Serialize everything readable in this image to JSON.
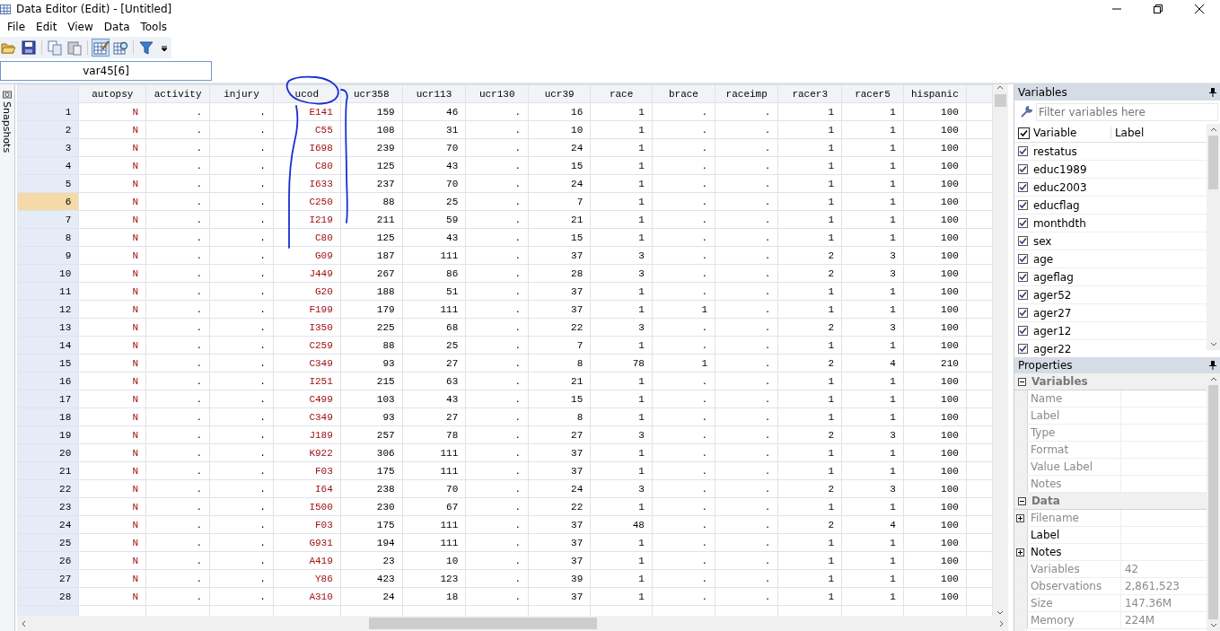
{
  "window": {
    "title": "Data Editor (Edit) - [Untitled]"
  },
  "menu": [
    "File",
    "Edit",
    "View",
    "Data",
    "Tools"
  ],
  "toolbar": [
    {
      "kind": "open",
      "selected": false
    },
    {
      "kind": "save",
      "selected": false
    },
    {
      "kind": "copy",
      "selected": false
    },
    {
      "kind": "paste",
      "selected": false
    },
    {
      "kind": "edit",
      "selected": true
    },
    {
      "kind": "browse",
      "selected": false
    },
    {
      "kind": "filter",
      "selected": false
    }
  ],
  "cell_reference": "var45[6]",
  "snapshots_tab": "Snapshots",
  "table": {
    "columns": [
      {
        "name": "autopsy",
        "kind": "string"
      },
      {
        "name": "activity",
        "kind": "numeric"
      },
      {
        "name": "injury",
        "kind": "numeric"
      },
      {
        "name": "ucod",
        "kind": "string"
      },
      {
        "name": "ucr358",
        "kind": "numeric"
      },
      {
        "name": "ucr113",
        "kind": "numeric"
      },
      {
        "name": "ucr130",
        "kind": "numeric"
      },
      {
        "name": "ucr39",
        "kind": "numeric"
      },
      {
        "name": "race",
        "kind": "numeric"
      },
      {
        "name": "brace",
        "kind": "numeric"
      },
      {
        "name": "raceimp",
        "kind": "numeric"
      },
      {
        "name": "racer3",
        "kind": "numeric"
      },
      {
        "name": "racer5",
        "kind": "numeric"
      },
      {
        "name": "hispanic",
        "kind": "numeric"
      }
    ],
    "rows": [
      {
        "n": "1",
        "selected": false,
        "cells": [
          "N",
          ".",
          ".",
          "E141",
          "159",
          "46",
          ".",
          "16",
          "1",
          ".",
          ".",
          "1",
          "1",
          "100"
        ]
      },
      {
        "n": "2",
        "selected": false,
        "cells": [
          "N",
          ".",
          ".",
          "C55",
          "108",
          "31",
          ".",
          "10",
          "1",
          ".",
          ".",
          "1",
          "1",
          "100"
        ]
      },
      {
        "n": "3",
        "selected": false,
        "cells": [
          "N",
          ".",
          ".",
          "I698",
          "239",
          "70",
          ".",
          "24",
          "1",
          ".",
          ".",
          "1",
          "1",
          "100"
        ]
      },
      {
        "n": "4",
        "selected": false,
        "cells": [
          "N",
          ".",
          ".",
          "C80",
          "125",
          "43",
          ".",
          "15",
          "1",
          ".",
          ".",
          "1",
          "1",
          "100"
        ]
      },
      {
        "n": "5",
        "selected": false,
        "cells": [
          "N",
          ".",
          ".",
          "I633",
          "237",
          "70",
          ".",
          "24",
          "1",
          ".",
          ".",
          "1",
          "1",
          "100"
        ]
      },
      {
        "n": "6",
        "selected": true,
        "cells": [
          "N",
          ".",
          ".",
          "C250",
          "88",
          "25",
          ".",
          "7",
          "1",
          ".",
          ".",
          "1",
          "1",
          "100"
        ]
      },
      {
        "n": "7",
        "selected": false,
        "cells": [
          "N",
          ".",
          ".",
          "I219",
          "211",
          "59",
          ".",
          "21",
          "1",
          ".",
          ".",
          "1",
          "1",
          "100"
        ]
      },
      {
        "n": "8",
        "selected": false,
        "cells": [
          "N",
          ".",
          ".",
          "C80",
          "125",
          "43",
          ".",
          "15",
          "1",
          ".",
          ".",
          "1",
          "1",
          "100"
        ]
      },
      {
        "n": "9",
        "selected": false,
        "cells": [
          "N",
          ".",
          ".",
          "G09",
          "187",
          "111",
          ".",
          "37",
          "3",
          ".",
          ".",
          "2",
          "3",
          "100"
        ]
      },
      {
        "n": "10",
        "selected": false,
        "cells": [
          "N",
          ".",
          ".",
          "J449",
          "267",
          "86",
          ".",
          "28",
          "3",
          ".",
          ".",
          "2",
          "3",
          "100"
        ]
      },
      {
        "n": "11",
        "selected": false,
        "cells": [
          "N",
          ".",
          ".",
          "G20",
          "188",
          "51",
          ".",
          "37",
          "1",
          ".",
          ".",
          "1",
          "1",
          "100"
        ]
      },
      {
        "n": "12",
        "selected": false,
        "cells": [
          "N",
          ".",
          ".",
          "F199",
          "179",
          "111",
          ".",
          "37",
          "1",
          "1",
          ".",
          "1",
          "1",
          "100"
        ]
      },
      {
        "n": "13",
        "selected": false,
        "cells": [
          "N",
          ".",
          ".",
          "I350",
          "225",
          "68",
          ".",
          "22",
          "3",
          ".",
          ".",
          "2",
          "3",
          "100"
        ]
      },
      {
        "n": "14",
        "selected": false,
        "cells": [
          "N",
          ".",
          ".",
          "C259",
          "88",
          "25",
          ".",
          "7",
          "1",
          ".",
          ".",
          "1",
          "1",
          "100"
        ]
      },
      {
        "n": "15",
        "selected": false,
        "cells": [
          "N",
          ".",
          ".",
          "C349",
          "93",
          "27",
          ".",
          "8",
          "78",
          "1",
          ".",
          "2",
          "4",
          "210"
        ]
      },
      {
        "n": "16",
        "selected": false,
        "cells": [
          "N",
          ".",
          ".",
          "I251",
          "215",
          "63",
          ".",
          "21",
          "1",
          ".",
          ".",
          "1",
          "1",
          "100"
        ]
      },
      {
        "n": "17",
        "selected": false,
        "cells": [
          "N",
          ".",
          ".",
          "C499",
          "103",
          "43",
          ".",
          "15",
          "1",
          ".",
          ".",
          "1",
          "1",
          "100"
        ]
      },
      {
        "n": "18",
        "selected": false,
        "cells": [
          "N",
          ".",
          ".",
          "C349",
          "93",
          "27",
          ".",
          "8",
          "1",
          ".",
          ".",
          "1",
          "1",
          "100"
        ]
      },
      {
        "n": "19",
        "selected": false,
        "cells": [
          "N",
          ".",
          ".",
          "J189",
          "257",
          "78",
          ".",
          "27",
          "3",
          ".",
          ".",
          "2",
          "3",
          "100"
        ]
      },
      {
        "n": "20",
        "selected": false,
        "cells": [
          "N",
          ".",
          ".",
          "K922",
          "306",
          "111",
          ".",
          "37",
          "1",
          ".",
          ".",
          "1",
          "1",
          "100"
        ]
      },
      {
        "n": "21",
        "selected": false,
        "cells": [
          "N",
          ".",
          ".",
          "F03",
          "175",
          "111",
          ".",
          "37",
          "1",
          ".",
          ".",
          "1",
          "1",
          "100"
        ]
      },
      {
        "n": "22",
        "selected": false,
        "cells": [
          "N",
          ".",
          ".",
          "I64",
          "238",
          "70",
          ".",
          "24",
          "3",
          ".",
          ".",
          "2",
          "3",
          "100"
        ]
      },
      {
        "n": "23",
        "selected": false,
        "cells": [
          "N",
          ".",
          ".",
          "I500",
          "230",
          "67",
          ".",
          "22",
          "1",
          ".",
          ".",
          "1",
          "1",
          "100"
        ]
      },
      {
        "n": "24",
        "selected": false,
        "cells": [
          "N",
          ".",
          ".",
          "F03",
          "175",
          "111",
          ".",
          "37",
          "48",
          ".",
          ".",
          "2",
          "4",
          "100"
        ]
      },
      {
        "n": "25",
        "selected": false,
        "cells": [
          "N",
          ".",
          ".",
          "G931",
          "194",
          "111",
          ".",
          "37",
          "1",
          ".",
          ".",
          "1",
          "1",
          "100"
        ]
      },
      {
        "n": "26",
        "selected": false,
        "cells": [
          "N",
          ".",
          ".",
          "A419",
          "23",
          "10",
          ".",
          "37",
          "1",
          ".",
          ".",
          "1",
          "1",
          "100"
        ]
      },
      {
        "n": "27",
        "selected": false,
        "cells": [
          "N",
          ".",
          ".",
          "Y86",
          "423",
          "123",
          ".",
          "39",
          "1",
          ".",
          ".",
          "1",
          "1",
          "100"
        ]
      },
      {
        "n": "28",
        "selected": false,
        "cells": [
          "N",
          ".",
          ".",
          "A310",
          "24",
          "18",
          ".",
          "37",
          "1",
          ".",
          ".",
          "1",
          "1",
          "100"
        ]
      }
    ]
  },
  "variables_panel": {
    "title": "Variables",
    "filter_placeholder": "Filter variables here",
    "all_checked": true,
    "columns": [
      "Variable",
      "Label"
    ],
    "items": [
      {
        "name": "restatus",
        "checked": true
      },
      {
        "name": "educ1989",
        "checked": true
      },
      {
        "name": "educ2003",
        "checked": true
      },
      {
        "name": "educflag",
        "checked": true
      },
      {
        "name": "monthdth",
        "checked": true
      },
      {
        "name": "sex",
        "checked": true
      },
      {
        "name": "age",
        "checked": true
      },
      {
        "name": "ageflag",
        "checked": true
      },
      {
        "name": "ager52",
        "checked": true
      },
      {
        "name": "ager27",
        "checked": true
      },
      {
        "name": "ager12",
        "checked": true
      },
      {
        "name": "ager22",
        "checked": true
      }
    ]
  },
  "properties_panel": {
    "title": "Properties",
    "sections": [
      {
        "title": "Variables",
        "expanded": true,
        "rows": [
          {
            "name": "Name",
            "disabled": true
          },
          {
            "name": "Label",
            "disabled": true
          },
          {
            "name": "Type",
            "disabled": true
          },
          {
            "name": "Format",
            "disabled": true
          },
          {
            "name": "Value Label",
            "disabled": true
          },
          {
            "name": "Notes",
            "disabled": true
          }
        ]
      },
      {
        "title": "Data",
        "expanded": true,
        "rows": [
          {
            "name": "Filename",
            "disabled": true,
            "expandable": true
          },
          {
            "name": "Label",
            "disabled": false
          },
          {
            "name": "Notes",
            "disabled": false,
            "expandable": true
          },
          {
            "name": "Variables",
            "value": "42",
            "disabled": true
          },
          {
            "name": "Observations",
            "value": "2,861,523",
            "disabled": true
          },
          {
            "name": "Size",
            "value": "147.36M",
            "disabled": true
          },
          {
            "name": "Memory",
            "value": "224M",
            "disabled": true
          }
        ]
      }
    ]
  }
}
